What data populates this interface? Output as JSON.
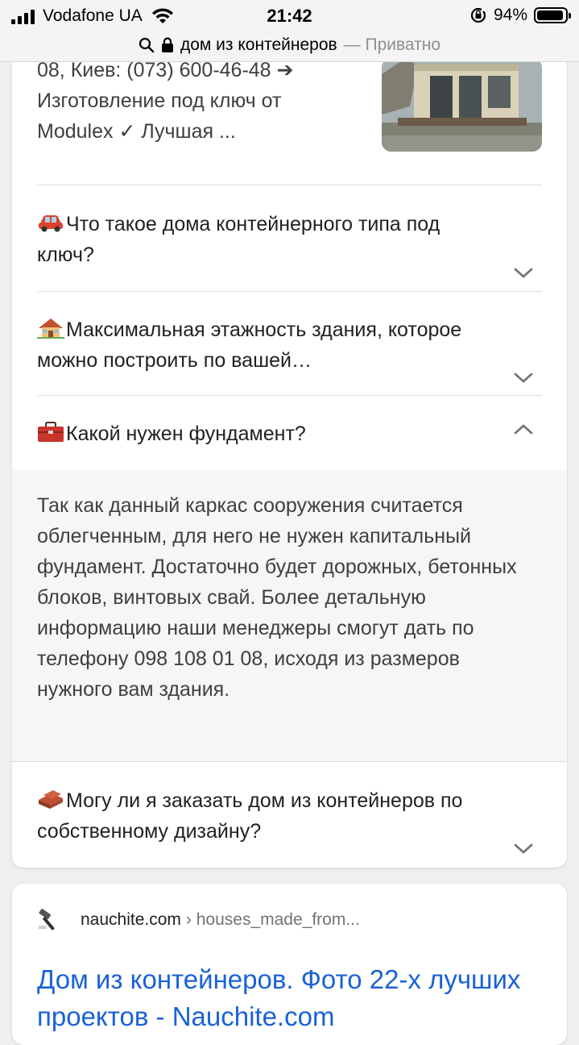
{
  "status_bar": {
    "carrier": "Vodafone UA",
    "time": "21:42",
    "battery_percent": "94%",
    "battery_level": 0.94
  },
  "url_bar": {
    "query": "дом из контейнеров",
    "private_label": "— Приватно"
  },
  "result1": {
    "snippet": [
      "08, Киев: (073) 600-46-48 ➔",
      "Изготовление под ключ от",
      "Modulex ✓ Лучшая  ..."
    ],
    "faq": [
      {
        "emoji": "car-emoji",
        "question": "Что такое дома контейнерного типа под ключ?",
        "expanded": false
      },
      {
        "emoji": "house-emoji",
        "question": "Максимальная этажность здания, которое можно построить по вашей…",
        "expanded": false
      },
      {
        "emoji": "toolbox-emoji",
        "question": "Какой нужен фундамент?",
        "expanded": true,
        "answer_lines": [
          "Так как данный каркас сооружения считается облегченным, для него не нужен капитальный фундамент. Достаточно будет дорожных, бетонных блоков, винтовых свай. Более детальную",
          "информацию наши менеджеры смогут дать по телефону 098 108 01 08, исходя из размеров нужного вам здания."
        ]
      },
      {
        "emoji": "bricks-emoji",
        "question": "Могу ли я заказать дом из контейнеров по собственному дизайну?",
        "expanded": false
      }
    ]
  },
  "result2": {
    "favicon": "hammer-icon",
    "domain": "nauchite.com",
    "path": "› houses_made_from...",
    "title": "Дом из контейнеров. Фото 22-х лучших проектов - Nauchite.com"
  },
  "colors": {
    "link": "#1a62d6",
    "text": "#3c4043",
    "divider": "#dadce0"
  }
}
